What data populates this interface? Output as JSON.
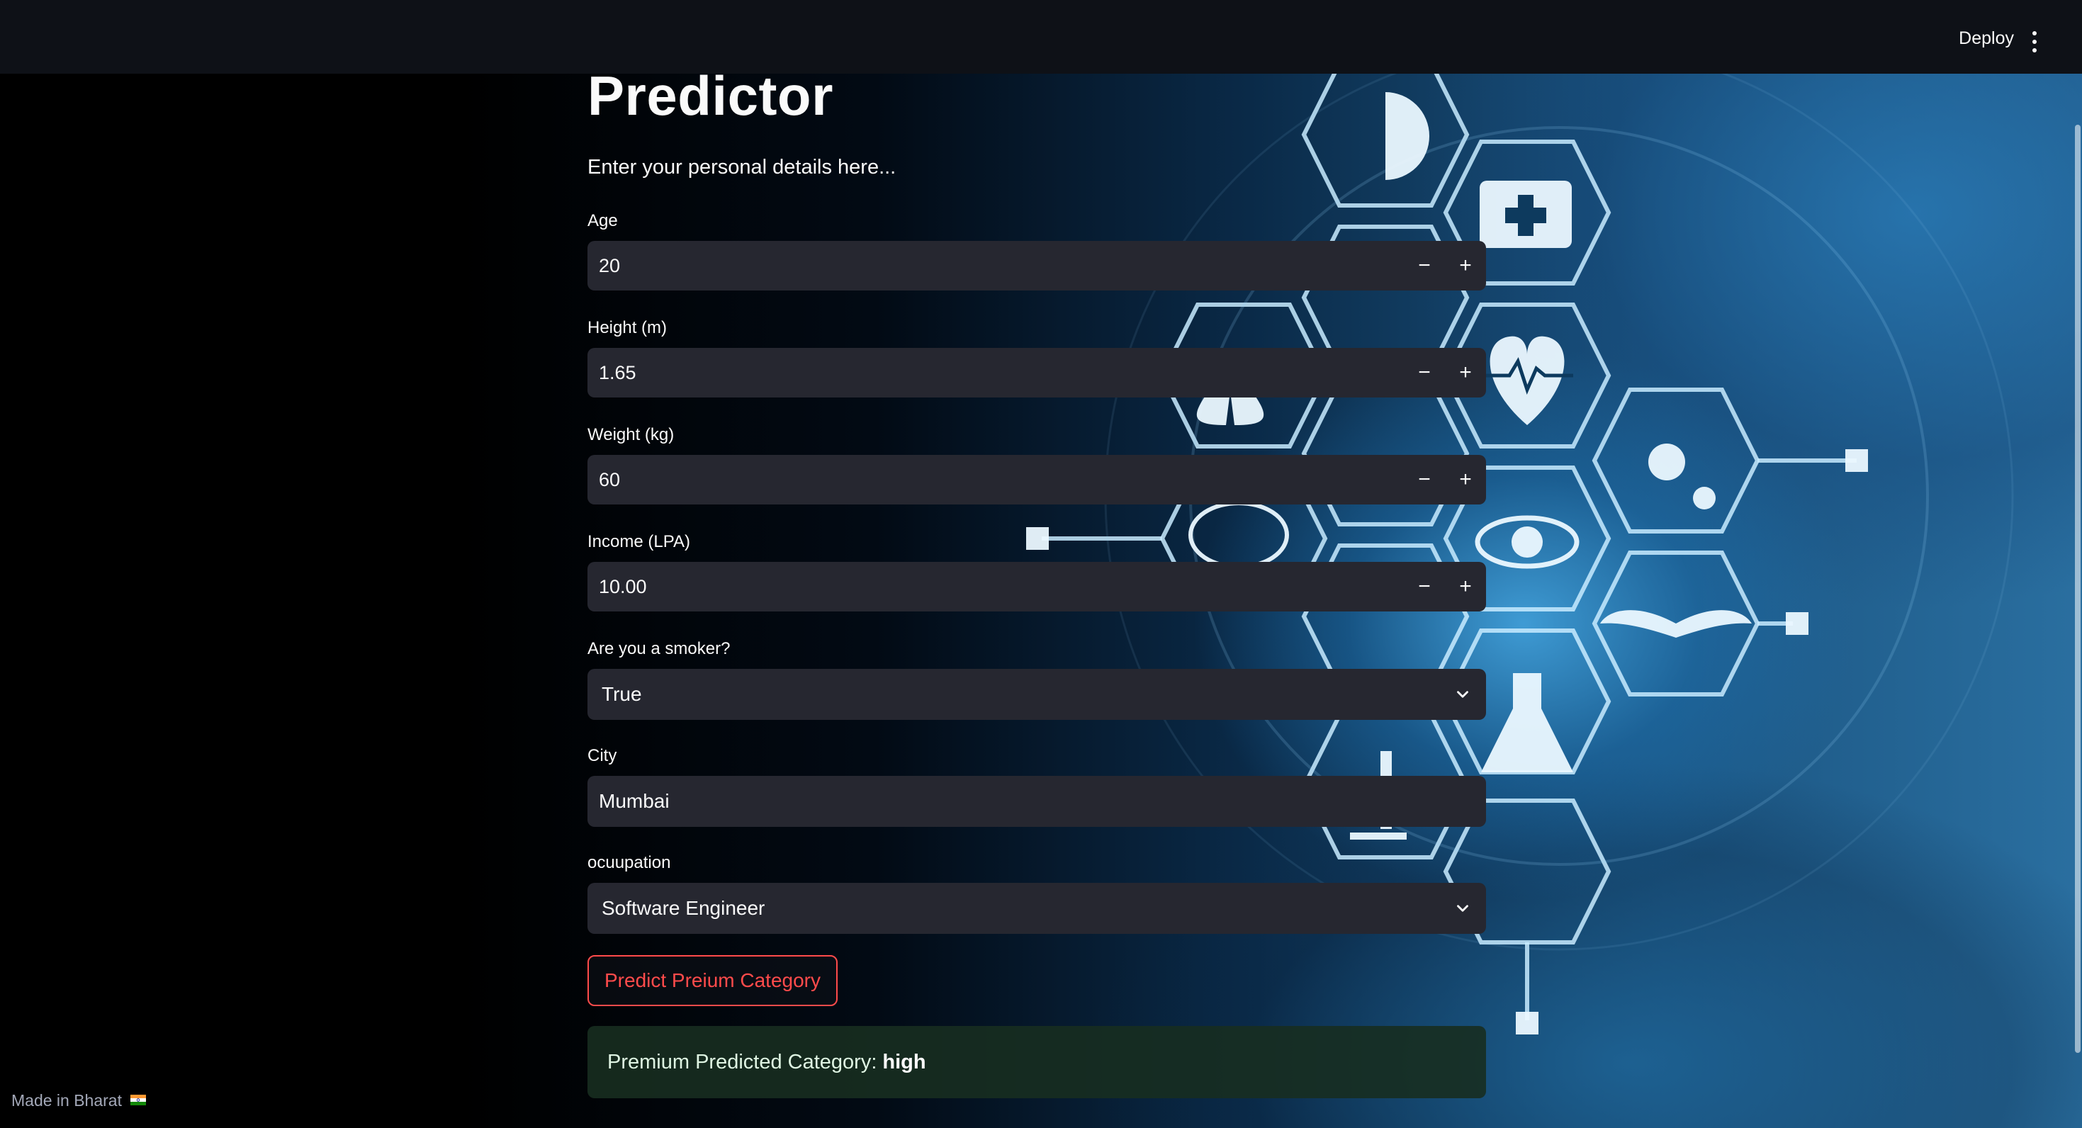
{
  "header": {
    "deploy_label": "Deploy"
  },
  "page": {
    "title": "Predictor",
    "subtitle": "Enter your personal details here..."
  },
  "form": {
    "age": {
      "label": "Age",
      "value": "20"
    },
    "height": {
      "label": "Height (m)",
      "value": "1.65"
    },
    "weight": {
      "label": "Weight (kg)",
      "value": "60"
    },
    "income": {
      "label": "Income (LPA)",
      "value": "10.00"
    },
    "smoker": {
      "label": "Are you a smoker?",
      "value": "True"
    },
    "city": {
      "label": "City",
      "value": "Mumbai"
    },
    "occupation": {
      "label": "ocuupation",
      "value": "Software Engineer"
    },
    "stepper": {
      "minus": "−",
      "plus": "+"
    }
  },
  "actions": {
    "predict_label": "Predict Preium Category"
  },
  "result": {
    "prefix": "Premium Predicted Category:",
    "value": "high"
  },
  "footer": {
    "note": "Made in Bharat"
  },
  "colors": {
    "header_bg": "#0e1117",
    "input_bg": "#262730",
    "accent": "#ff4b4b",
    "success_bg": "#172d20"
  },
  "icons": [
    "chevron-down-icon",
    "more-vert-icon",
    "india-flag-icon"
  ]
}
